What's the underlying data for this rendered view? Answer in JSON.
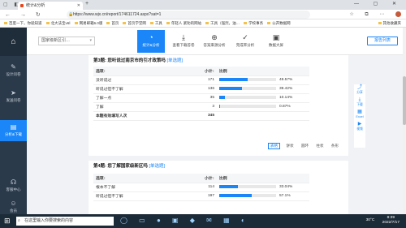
{
  "browser": {
    "tab_title": "统计&分析",
    "url": "https://www.wjx.cn/report/174611724.aspx?sat=1",
    "bookmarks": [
      "百度一下，你就知道",
      "北大法宝v6Ⅰ",
      "网易邮箱6.0版",
      "首页",
      "首页学堂网",
      "工具",
      "年轻人 紧劝的网站",
      "工具（强烈，油…",
      "学校事务",
      "公开数据网"
    ],
    "other_bookmarks": "其他收藏夹"
  },
  "sidebar": {
    "items": [
      {
        "label": "设计问卷",
        "icon": "pencil-icon"
      },
      {
        "label": "发送问卷",
        "icon": "send-icon"
      },
      {
        "label": "分析&下载",
        "icon": "chart-icon"
      },
      {
        "label": "客服中心",
        "icon": "headset-icon"
      },
      {
        "label": "会员",
        "icon": "user-icon"
      }
    ]
  },
  "toolbar": {
    "select_value": "国家级新区引…",
    "tools": [
      {
        "label": "统计&分析",
        "icon": "pie-chart-icon"
      },
      {
        "label": "查看下载答卷",
        "icon": "download-icon"
      },
      {
        "label": "答案来源分析",
        "icon": "target-icon"
      },
      {
        "label": "完成率分析",
        "icon": "check-icon"
      },
      {
        "label": "数据大屏",
        "icon": "dashboard-icon"
      }
    ],
    "report_button": "报告列表"
  },
  "question3": {
    "title": "第3题: 您听说过南京市的引才政策吗",
    "type": "[单选题]",
    "headers": [
      "选项↕",
      "小计↕",
      "比例"
    ],
    "rows": [
      {
        "option": "没听说过",
        "count": "171",
        "pct": "49.57%",
        "value": 49.57
      },
      {
        "option": "听说过但不了解",
        "count": "136",
        "pct": "39.42%",
        "value": 39.42
      },
      {
        "option": "了解一点",
        "count": "35",
        "pct": "10.14%",
        "value": 10.14
      },
      {
        "option": "了解",
        "count": "3",
        "pct": "0.87%",
        "value": 0.87
      }
    ],
    "total_label": "本题有效填写人次",
    "total_value": "345"
  },
  "view_options": [
    "表格",
    "饼状",
    "圆环",
    "柱状",
    "条形"
  ],
  "question4": {
    "title": "第4题: 您了解国家级新区吗",
    "type": "[单选题]",
    "headers": [
      "选项↕",
      "小计↕",
      "比例"
    ],
    "rows": [
      {
        "option": "根本不了解",
        "count": "114",
        "pct": "33.04%",
        "value": 33.04
      },
      {
        "option": "听说过但不了解",
        "count": "197",
        "pct": "57.1%",
        "value": 57.1
      }
    ]
  },
  "floatbar": [
    "分享",
    "下载",
    "Excel",
    "视频"
  ],
  "taskbar": {
    "search_placeholder": "在这里输入你要搜索的内容",
    "weather": "30°C",
    "time": "8:39",
    "date": "2022/7/17"
  },
  "colors": {
    "accent": "#1a86f7",
    "sidebar": "#2b3a4a",
    "taskbar": "#1c2b38"
  }
}
